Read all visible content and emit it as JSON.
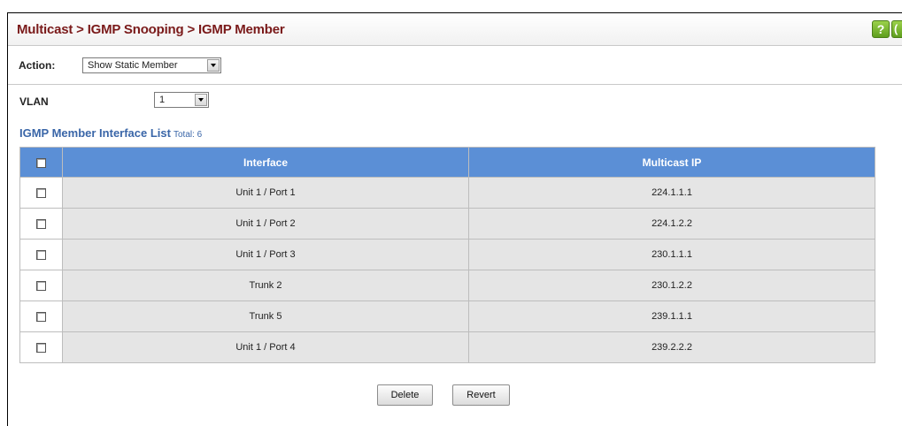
{
  "header": {
    "title": "Multicast > IGMP Snooping > IGMP Member",
    "help_icon": "?",
    "help_icon2": "("
  },
  "action": {
    "label": "Action:",
    "selected": "Show Static Member"
  },
  "vlan": {
    "label": "VLAN",
    "selected": "1"
  },
  "list": {
    "title": "IGMP Member Interface List",
    "total": "Total: 6",
    "columns": [
      "Interface",
      "Multicast IP"
    ],
    "rows": [
      [
        "Unit 1 / Port 1",
        "224.1.1.1"
      ],
      [
        "Unit 1 / Port 2",
        "224.1.2.2"
      ],
      [
        "Unit 1 / Port 3",
        "230.1.1.1"
      ],
      [
        "Trunk 2",
        "230.1.2.2"
      ],
      [
        "Trunk 5",
        "239.1.1.1"
      ],
      [
        "Unit 1 / Port 4",
        "239.2.2.2"
      ]
    ]
  },
  "buttons": {
    "delete": "Delete",
    "revert": "Revert"
  },
  "colors": {
    "title": "#7a1a1a",
    "header_bg": "#5b8fd6",
    "list_title": "#3a66a8",
    "row_bg": "#e5e5e5"
  }
}
